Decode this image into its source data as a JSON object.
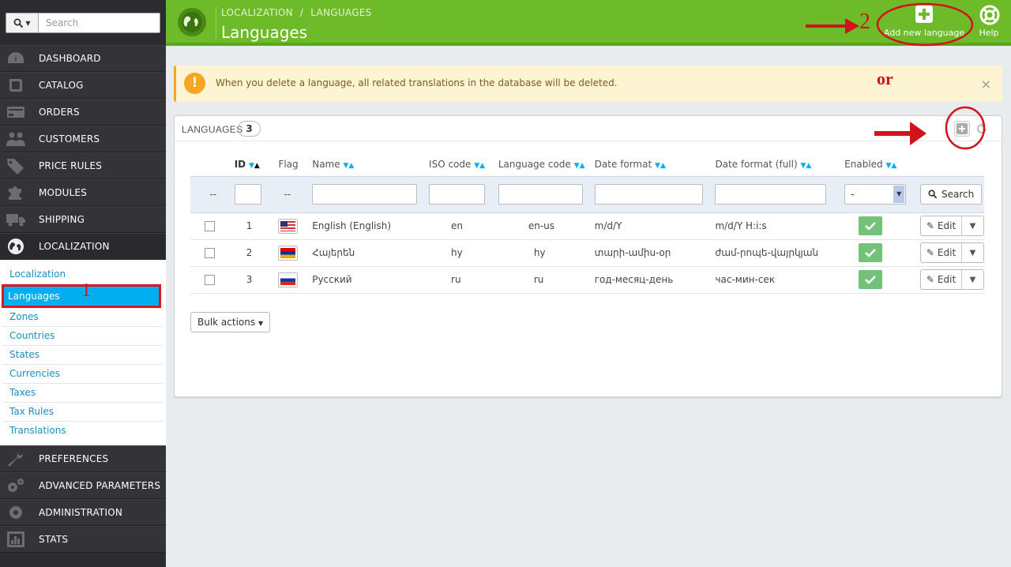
{
  "sidebar": {
    "search_placeholder": "Search",
    "menu_top": [
      {
        "label": "DASHBOARD",
        "icon": "dashboard-icon"
      },
      {
        "label": "CATALOG",
        "icon": "book-icon"
      },
      {
        "label": "ORDERS",
        "icon": "credit-card-icon"
      },
      {
        "label": "CUSTOMERS",
        "icon": "users-icon"
      },
      {
        "label": "PRICE RULES",
        "icon": "tags-icon"
      },
      {
        "label": "MODULES",
        "icon": "puzzle-icon"
      },
      {
        "label": "SHIPPING",
        "icon": "truck-icon"
      },
      {
        "label": "LOCALIZATION",
        "icon": "globe-icon"
      }
    ],
    "submenu": [
      "Localization",
      "Languages",
      "Zones",
      "Countries",
      "States",
      "Currencies",
      "Taxes",
      "Tax Rules",
      "Translations"
    ],
    "menu_bottom": [
      {
        "label": "PREFERENCES",
        "icon": "wrench-icon"
      },
      {
        "label": "ADVANCED PARAMETERS",
        "icon": "cogs-icon"
      },
      {
        "label": "ADMINISTRATION",
        "icon": "gear-icon"
      },
      {
        "label": "STATS",
        "icon": "bar-chart-icon"
      }
    ]
  },
  "header": {
    "breadcrumb_parent": "LOCALIZATION",
    "breadcrumb_sep": "/",
    "breadcrumb_current": "LANGUAGES",
    "title": "Languages",
    "add_label": "Add new language",
    "help_label": "Help"
  },
  "alert": {
    "text": "When you delete a language, all related translations in the database will be deleted.",
    "close": "×"
  },
  "panel": {
    "title": "LANGUAGES",
    "count": "3",
    "columns": [
      "ID",
      "Flag",
      "Name",
      "ISO code",
      "Language code",
      "Date format",
      "Date format (full)",
      "Enabled"
    ],
    "filter_dash": "--",
    "enabled_filter_value": "-",
    "search_label": "Search",
    "edit_label": "Edit",
    "rows": [
      {
        "id": "1",
        "name": "English (English)",
        "iso": "en",
        "lang_code": "en-us",
        "date_format": "m/d/Y",
        "date_full": "m/d/Y H:i:s",
        "flag": "us"
      },
      {
        "id": "2",
        "name": "Հայերեն",
        "iso": "hy",
        "lang_code": "hy",
        "date_format": "տարի-ամիս-օր",
        "date_full": "ժամ-րոպե-վայրկյան",
        "flag": "am"
      },
      {
        "id": "3",
        "name": "Русский",
        "iso": "ru",
        "lang_code": "ru",
        "date_format": "год-месяц-день",
        "date_full": "час-мин-сек",
        "flag": "ru"
      }
    ],
    "bulk_label": "Bulk actions"
  },
  "annotations": {
    "step1": "1",
    "step2": "2",
    "or": "or"
  },
  "colors": {
    "header_green": "#6dbb28",
    "sidebar": "#2c2c30",
    "accent_blue": "#00aff0",
    "annotation_red": "#d1141b"
  }
}
